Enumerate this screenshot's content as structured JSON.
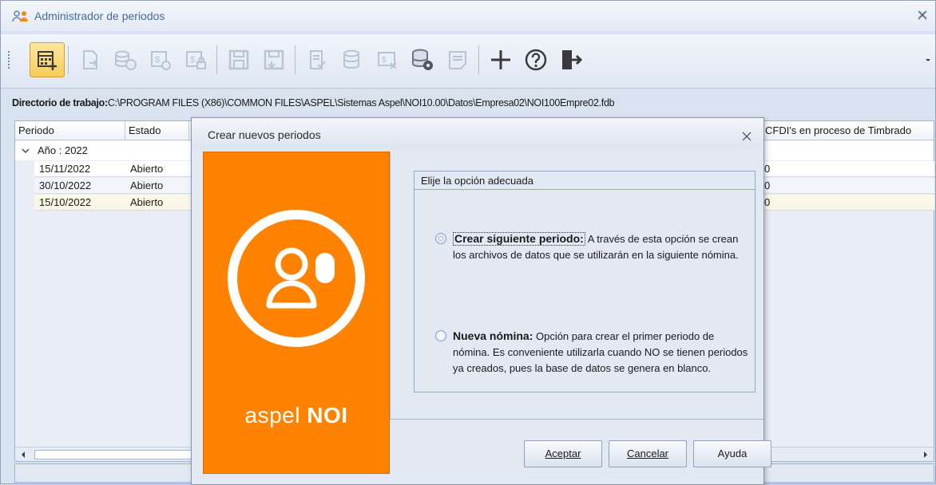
{
  "window": {
    "title": "Administrador de periodos"
  },
  "dirbar": {
    "label": "Directorio de trabajo:",
    "path": "C:\\PROGRAM FILES (X86)\\COMMON FILES\\ASPEL\\Sistemas Aspel\\NOI10.00\\Datos\\Empresa02\\NOI100Empre02.fdb"
  },
  "grid": {
    "columns": [
      "Periodo",
      "Estado",
      "CFDI's en proceso de Timbrado"
    ],
    "group_label": "Año : 2022",
    "rows": [
      {
        "periodo": "15/11/2022",
        "estado": "Abierto",
        "cfdi": "0"
      },
      {
        "periodo": "30/10/2022",
        "estado": "Abierto",
        "cfdi": "0"
      },
      {
        "periodo": "15/10/2022",
        "estado": "Abierto",
        "cfdi": "0"
      }
    ]
  },
  "dialog": {
    "title": "Crear nuevos periodos",
    "brand_left": "aspel",
    "brand_right": "NOI",
    "legend": "Elije la opción adecuada",
    "options": [
      {
        "title": "Crear siguiente periodo:",
        "text": " A través de esta opción se crean los archivos de datos que se utilizarán en la siguiente nómina.",
        "selected": true
      },
      {
        "title": "Nueva nómina:",
        "text": " Opción para crear el primer periodo de nómina. Es conveniente utilizarla cuando NO se tienen periodos ya creados, pues la base de datos se genera en blanco.",
        "selected": false
      }
    ],
    "buttons": {
      "accept": "Aceptar",
      "cancel": "Cancelar",
      "help": "Ayuda"
    }
  },
  "colors": {
    "brand_orange": "#ff8200",
    "window_bg": "#d9e3f0",
    "title_text": "#4a6a97"
  },
  "icons": [
    "period-manager-icon",
    "close-icon",
    "calendar-add-icon",
    "document-arrow-icon",
    "coins-refresh-icon",
    "money-gear-icon",
    "money-lock-icon",
    "save-period-icon",
    "save-period-alt-icon",
    "document-check-icon",
    "database-icon",
    "receipt-delete-icon",
    "database-gear-icon",
    "notes-icon",
    "plus-icon",
    "help-icon",
    "exit-icon",
    "chevron-down-icon"
  ]
}
